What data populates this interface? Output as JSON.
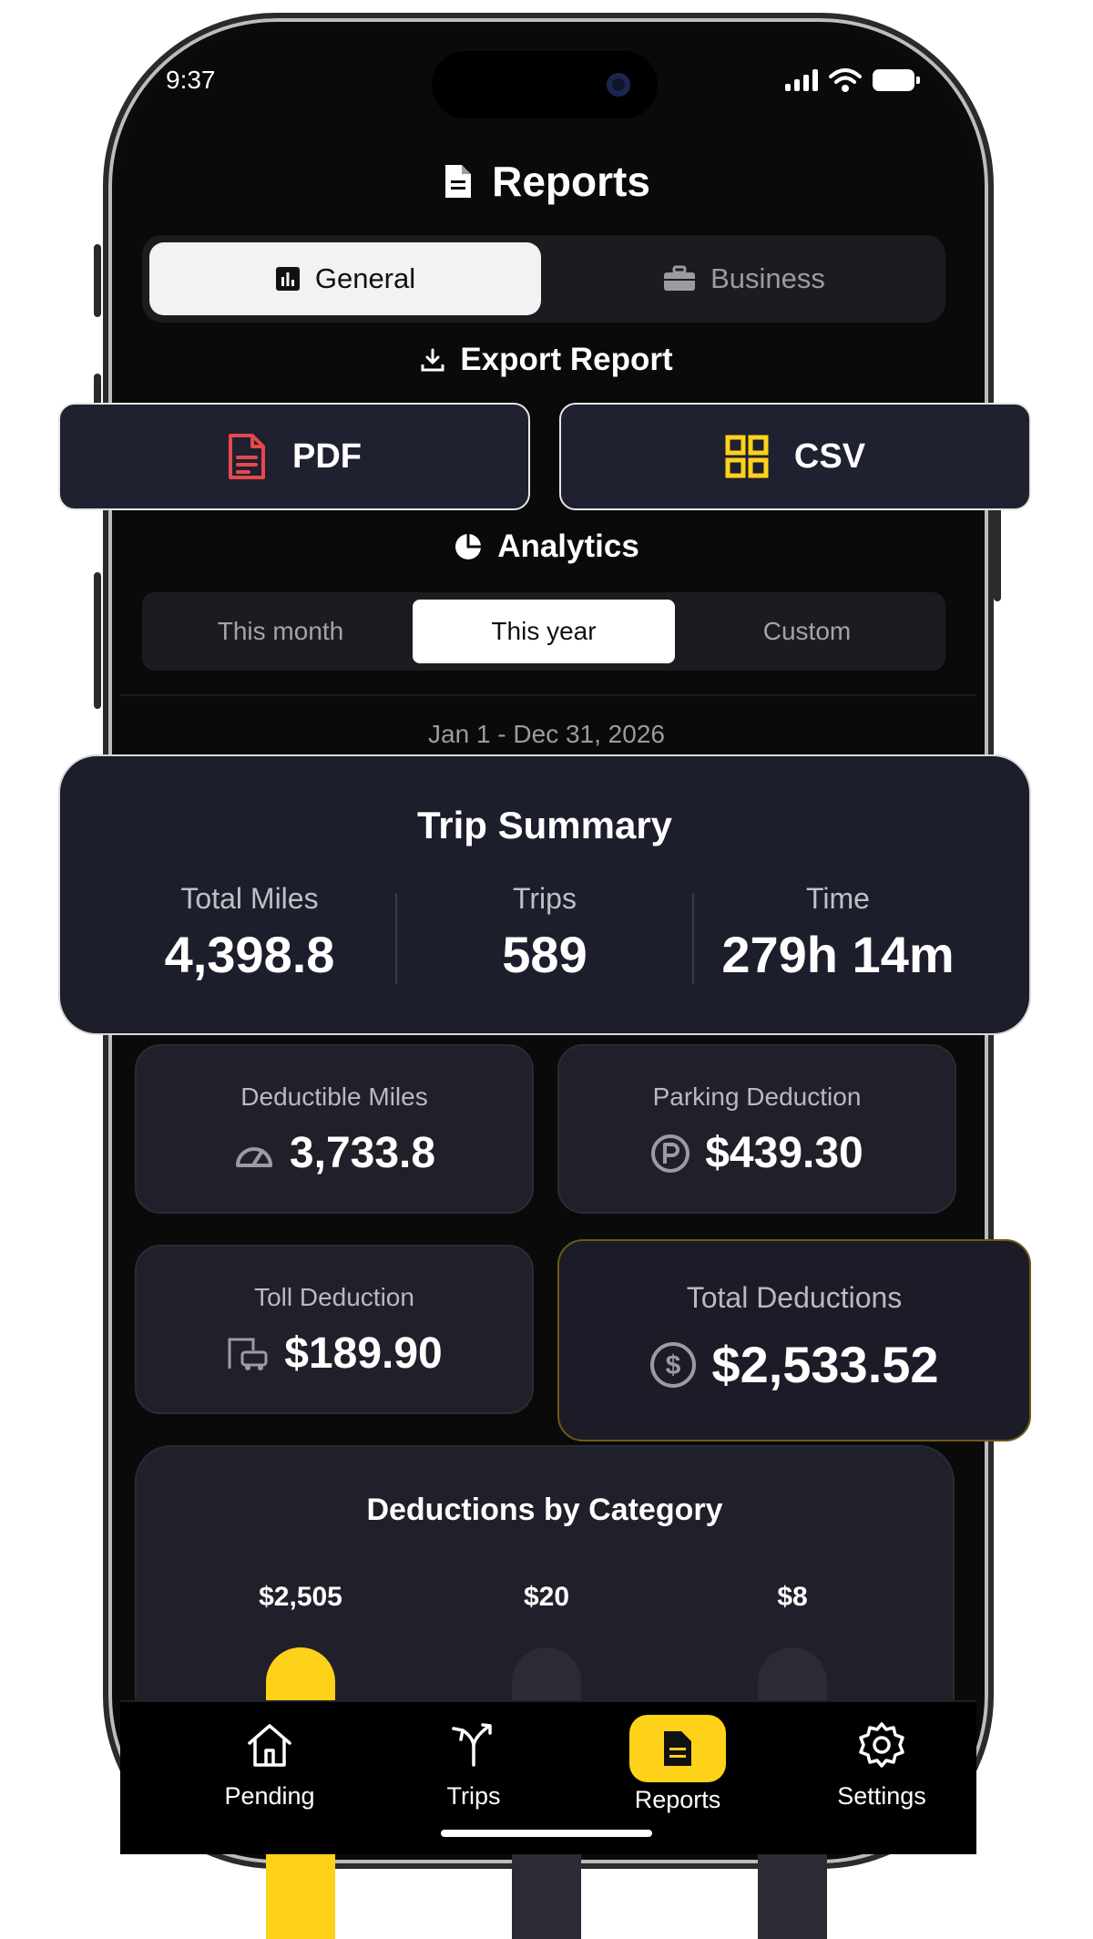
{
  "status": {
    "time": "9:37"
  },
  "header": {
    "title": "Reports",
    "icon": "document-icon"
  },
  "report_tabs": [
    {
      "label": "General",
      "icon": "bar-chart-icon",
      "active": true
    },
    {
      "label": "Business",
      "icon": "briefcase-icon",
      "active": false
    }
  ],
  "export": {
    "title": "Export Report",
    "pdf_label": "PDF",
    "csv_label": "CSV"
  },
  "analytics": {
    "title": "Analytics",
    "ranges": [
      "This month",
      "This year",
      "Custom"
    ],
    "selected_range": "This year",
    "date_range": "Jan 1 - Dec 31, 2026"
  },
  "trip_summary": {
    "title": "Trip Summary",
    "total_miles_label": "Total Miles",
    "total_miles": "4,398.8",
    "trips_label": "Trips",
    "trips": "589",
    "time_label": "Time",
    "time": "279h 14m"
  },
  "deductions": {
    "deductible_miles_label": "Deductible Miles",
    "deductible_miles": "3,733.8",
    "parking_label": "Parking Deduction",
    "parking": "$439.30",
    "toll_label": "Toll Deduction",
    "toll": "$189.90",
    "total_label": "Total Deductions",
    "total": "$2,533.52"
  },
  "chart_data": {
    "type": "bar",
    "title": "Deductions by Category",
    "data_labels": [
      "$2,505",
      "$20",
      "$8"
    ],
    "values": [
      2505,
      20,
      8
    ]
  },
  "nav": [
    {
      "label": "Pending",
      "icon": "home-icon",
      "active": false
    },
    {
      "label": "Trips",
      "icon": "route-split-icon",
      "active": false
    },
    {
      "label": "Reports",
      "icon": "document-icon",
      "active": true
    },
    {
      "label": "Settings",
      "icon": "gear-icon",
      "active": false
    }
  ],
  "colors": {
    "accent": "#ffd21a",
    "pdf": "#e5484d",
    "csv": "#ffd21a",
    "card": "#1f2029"
  }
}
